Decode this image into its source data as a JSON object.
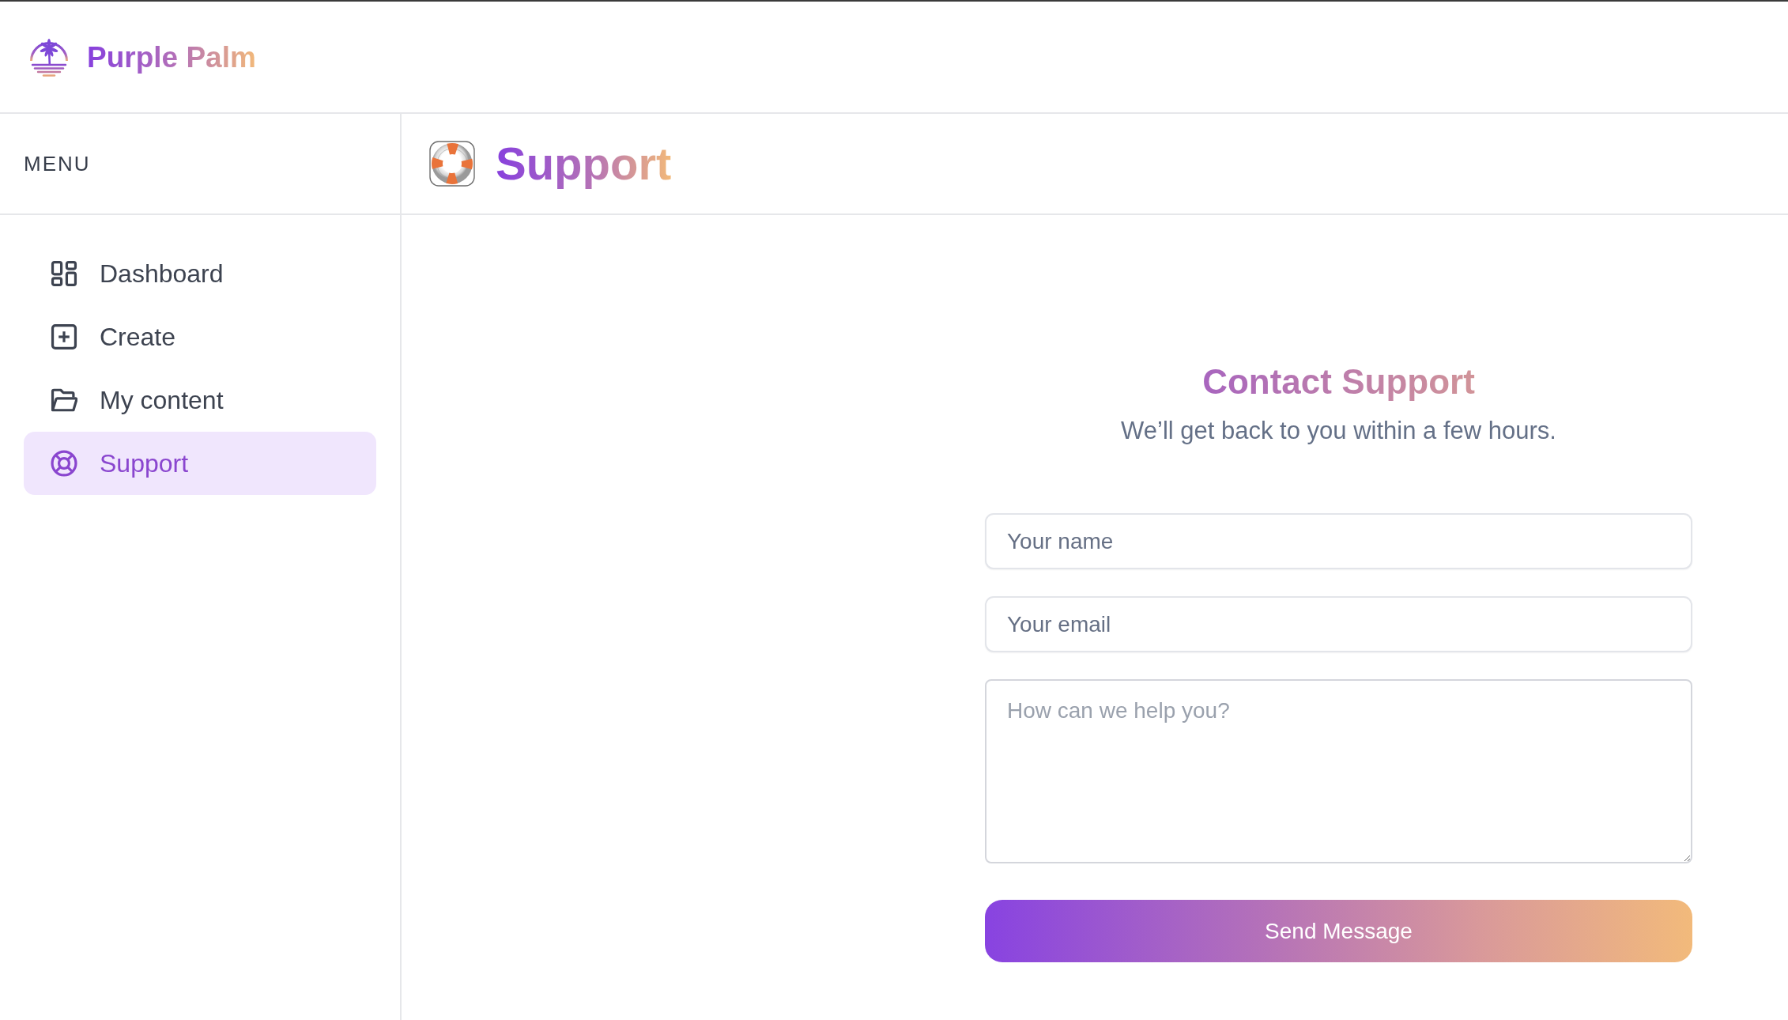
{
  "brand": {
    "name": "Purple Palm"
  },
  "sidebar": {
    "heading": "MENU",
    "items": [
      {
        "kind": "grid",
        "label": "Dashboard",
        "selected": false
      },
      {
        "kind": "plus",
        "label": "Create",
        "selected": false
      },
      {
        "kind": "folder",
        "label": "My content",
        "selected": false
      },
      {
        "kind": "lifebuoy",
        "label": "Support",
        "selected": true
      }
    ]
  },
  "page_header": {
    "title": "Support"
  },
  "contact_form": {
    "title": "Contact Support",
    "subtitle": "We’ll get back to you within a few hours.",
    "fields": [
      {
        "kind": "text",
        "placeholder": "Your name"
      },
      {
        "kind": "email",
        "placeholder": "Your email"
      },
      {
        "kind": "textarea",
        "placeholder": "How can we help you?"
      }
    ],
    "submit_button": "Send Message"
  }
}
